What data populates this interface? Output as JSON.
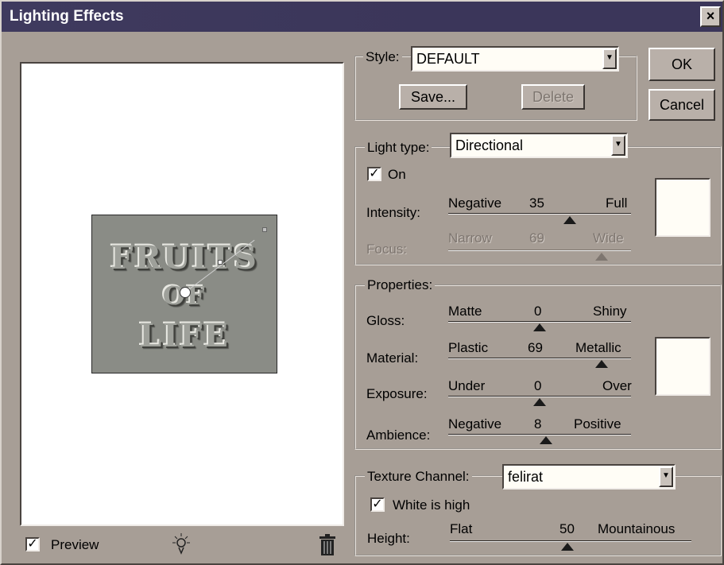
{
  "window": {
    "title": "Lighting Effects",
    "close_glyph": "×"
  },
  "preview": {
    "text_line1": "FRUITS",
    "text_line2": "OF",
    "text_line3": "LIFE",
    "checkbox_label": "Preview",
    "checked": true
  },
  "style": {
    "label": "Style:",
    "value": "DEFAULT",
    "save_label": "Save...",
    "delete_label": "Delete"
  },
  "buttons": {
    "ok": "OK",
    "cancel": "Cancel"
  },
  "light": {
    "type_label": "Light type:",
    "type_value": "Directional",
    "on_label": "On",
    "on_checked": true,
    "intensity": {
      "label": "Intensity:",
      "min": "Negative",
      "value": "35",
      "max": "Full"
    },
    "focus": {
      "label": "Focus:",
      "min": "Narrow",
      "value": "69",
      "max": "Wide"
    }
  },
  "properties": {
    "label": "Properties:",
    "gloss": {
      "label": "Gloss:",
      "min": "Matte",
      "value": "0",
      "max": "Shiny"
    },
    "material": {
      "label": "Material:",
      "min": "Plastic",
      "value": "69",
      "max": "Metallic"
    },
    "exposure": {
      "label": "Exposure:",
      "min": "Under",
      "value": "0",
      "max": "Over"
    },
    "ambience": {
      "label": "Ambience:",
      "min": "Negative",
      "value": "8",
      "max": "Positive"
    }
  },
  "texture": {
    "label": "Texture Channel:",
    "value": "felirat",
    "white_high_label": "White is high",
    "white_high_checked": true,
    "height": {
      "label": "Height:",
      "min": "Flat",
      "value": "50",
      "max": "Mountainous"
    }
  },
  "icons": {
    "light_bulb": "light-bulb-icon",
    "trash": "trash-icon",
    "dropdown": "chevron-down-icon"
  },
  "colors": {
    "dialog_bg": "#a79e96",
    "titlebar": "#3b365a",
    "swatch": "#fffdf6"
  }
}
